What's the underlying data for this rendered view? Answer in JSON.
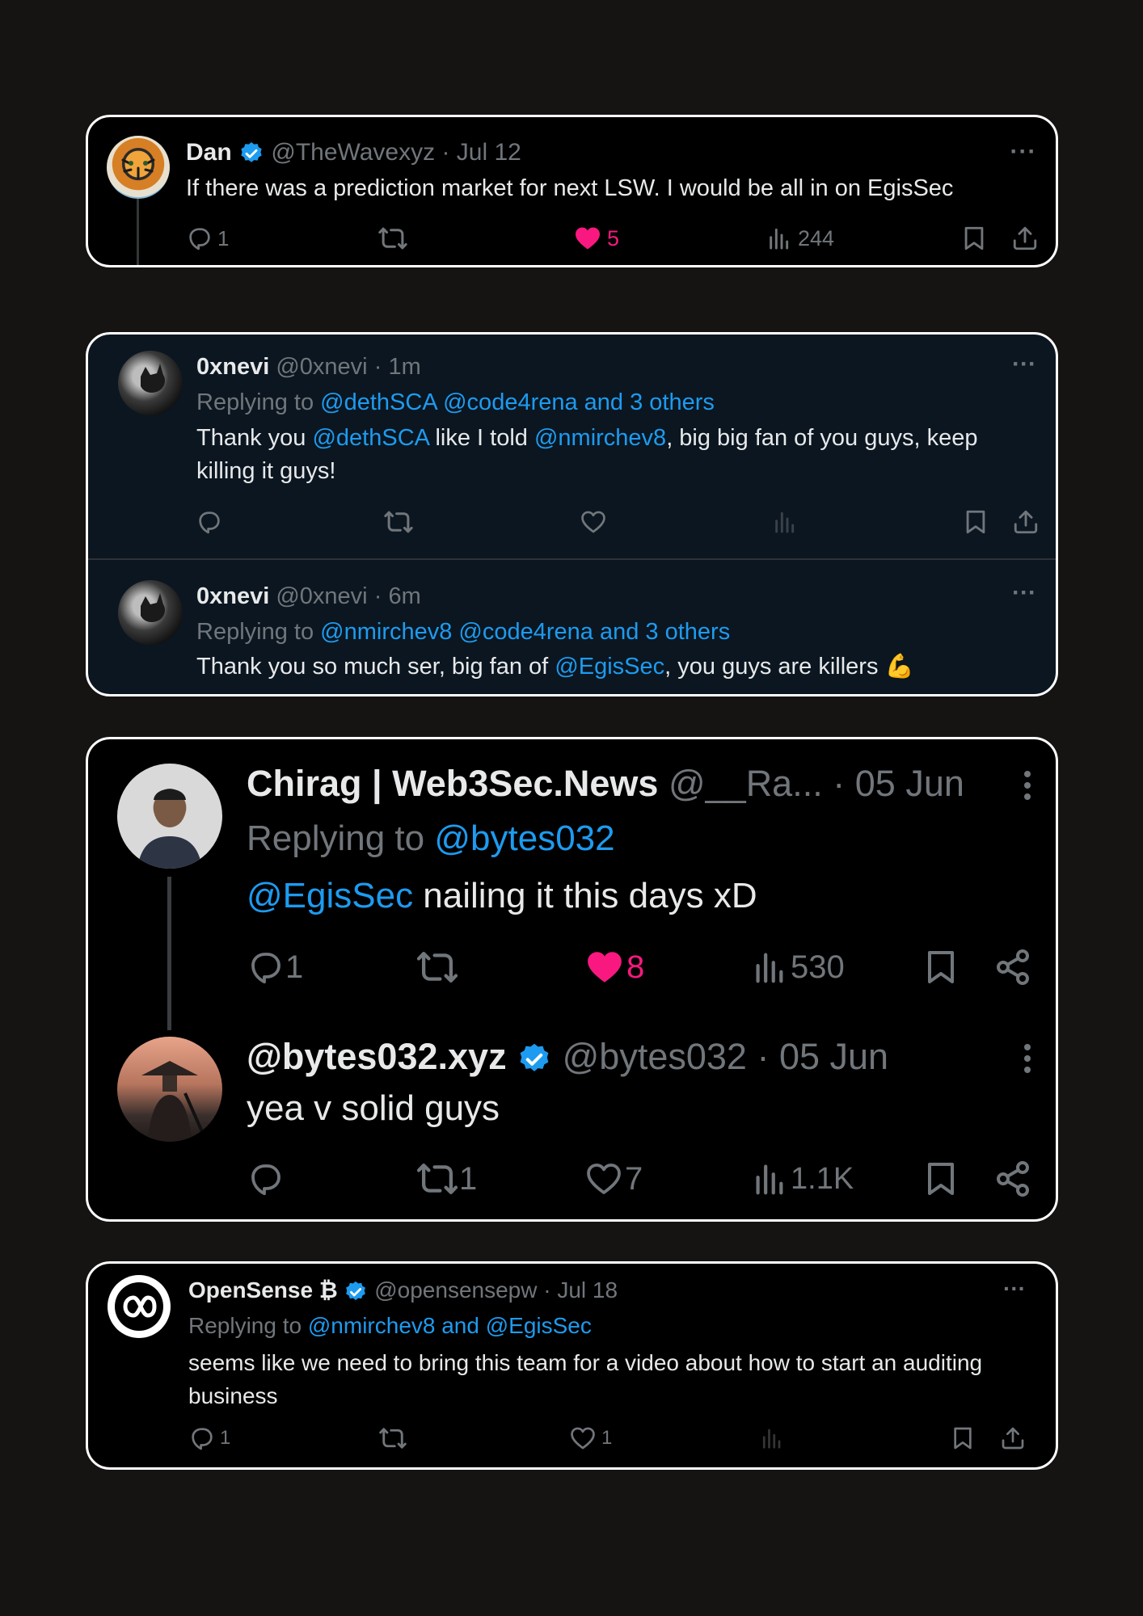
{
  "tweet1": {
    "name": "Dan",
    "handle": "@TheWavexyz",
    "date": "Jul 12",
    "text": "If there was a prediction market for next LSW. I would be all in on EgisSec",
    "replies": "1",
    "likes": "5",
    "views": "244"
  },
  "card2": {
    "a": {
      "name": "0xnevi",
      "handle": "@0xnevi",
      "time": "1m",
      "replying_prefix": "Replying to ",
      "replying_targets": "@dethSCA @code4rena and 3 others",
      "text_1": "Thank you ",
      "mention_1": "@dethSCA",
      "text_2": " like I told ",
      "mention_2": "@nmirchev8",
      "text_3": ", big big fan of you guys, keep killing it guys!"
    },
    "b": {
      "name": "0xnevi",
      "handle": "@0xnevi",
      "time": "6m",
      "replying_prefix": "Replying to ",
      "replying_targets": "@nmirchev8 @code4rena and 3 others",
      "text_1": "Thank you so much ser, big fan of ",
      "mention_1": "@EgisSec",
      "text_2": ", you guys are killers ",
      "emoji": "💪"
    }
  },
  "card3": {
    "a": {
      "name": "Chirag | Web3Sec.News",
      "handle": "@__Ra...",
      "date": "05 Jun",
      "replying_prefix": "Replying to ",
      "replying_targets": "@bytes032",
      "mention": "@EgisSec",
      "text": " nailing it this days xD",
      "replies": "1",
      "likes": "8",
      "views": "530"
    },
    "b": {
      "name": "@bytes032.xyz",
      "handle": "@bytes032",
      "date": "05 Jun",
      "text": "yea v solid guys",
      "retweets": "1",
      "likes": "7",
      "views": "1.1K"
    }
  },
  "card4": {
    "name": "OpenSense",
    "name_suffix": "₿",
    "handle": "@opensensepw",
    "date": "Jul 18",
    "replying_prefix": "Replying to ",
    "replying_targets": "@nmirchev8 and @EgisSec",
    "text": "seems like we need to bring this team for a video about how to start an auditing business",
    "replies": "1",
    "likes": "1"
  },
  "colors": {
    "link": "#1d9bf0",
    "like": "#f91880",
    "muted": "#71767b",
    "verified": "#1d9bf0",
    "card_border": "#ffffff",
    "page_bg": "#161313"
  },
  "icons": [
    "reply-icon",
    "retweet-icon",
    "heart-icon",
    "views-icon",
    "bookmark-icon",
    "share-icon",
    "more-icon",
    "verified-badge-icon"
  ]
}
